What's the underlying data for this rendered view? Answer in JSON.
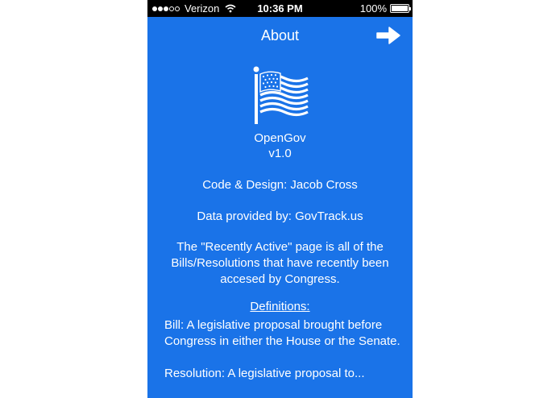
{
  "status_bar": {
    "signal_dots": [
      true,
      true,
      true,
      false,
      false
    ],
    "carrier": "Verizon",
    "time": "10:36 PM",
    "battery": "100%"
  },
  "nav": {
    "title": "About",
    "forward_icon": "arrow-right-icon"
  },
  "about": {
    "logo_icon": "american-flag-icon",
    "app_name": "OpenGov",
    "version": "v1.0",
    "credit": "Code & Design: Jacob Cross",
    "data_source": "Data provided by: GovTrack.us",
    "description": "The \"Recently Active\" page is all of the Bills/Resolutions that have recently been accesed by Congress.",
    "definitions_heading": "Definitions:",
    "definitions": [
      "Bill: A legislative proposal brought before Congress in either the House or the Senate.",
      "Resolution: A legislative proposal to..."
    ]
  },
  "colors": {
    "background": "#1a73e8",
    "status_bar": "#000000",
    "text": "#ffffff"
  }
}
